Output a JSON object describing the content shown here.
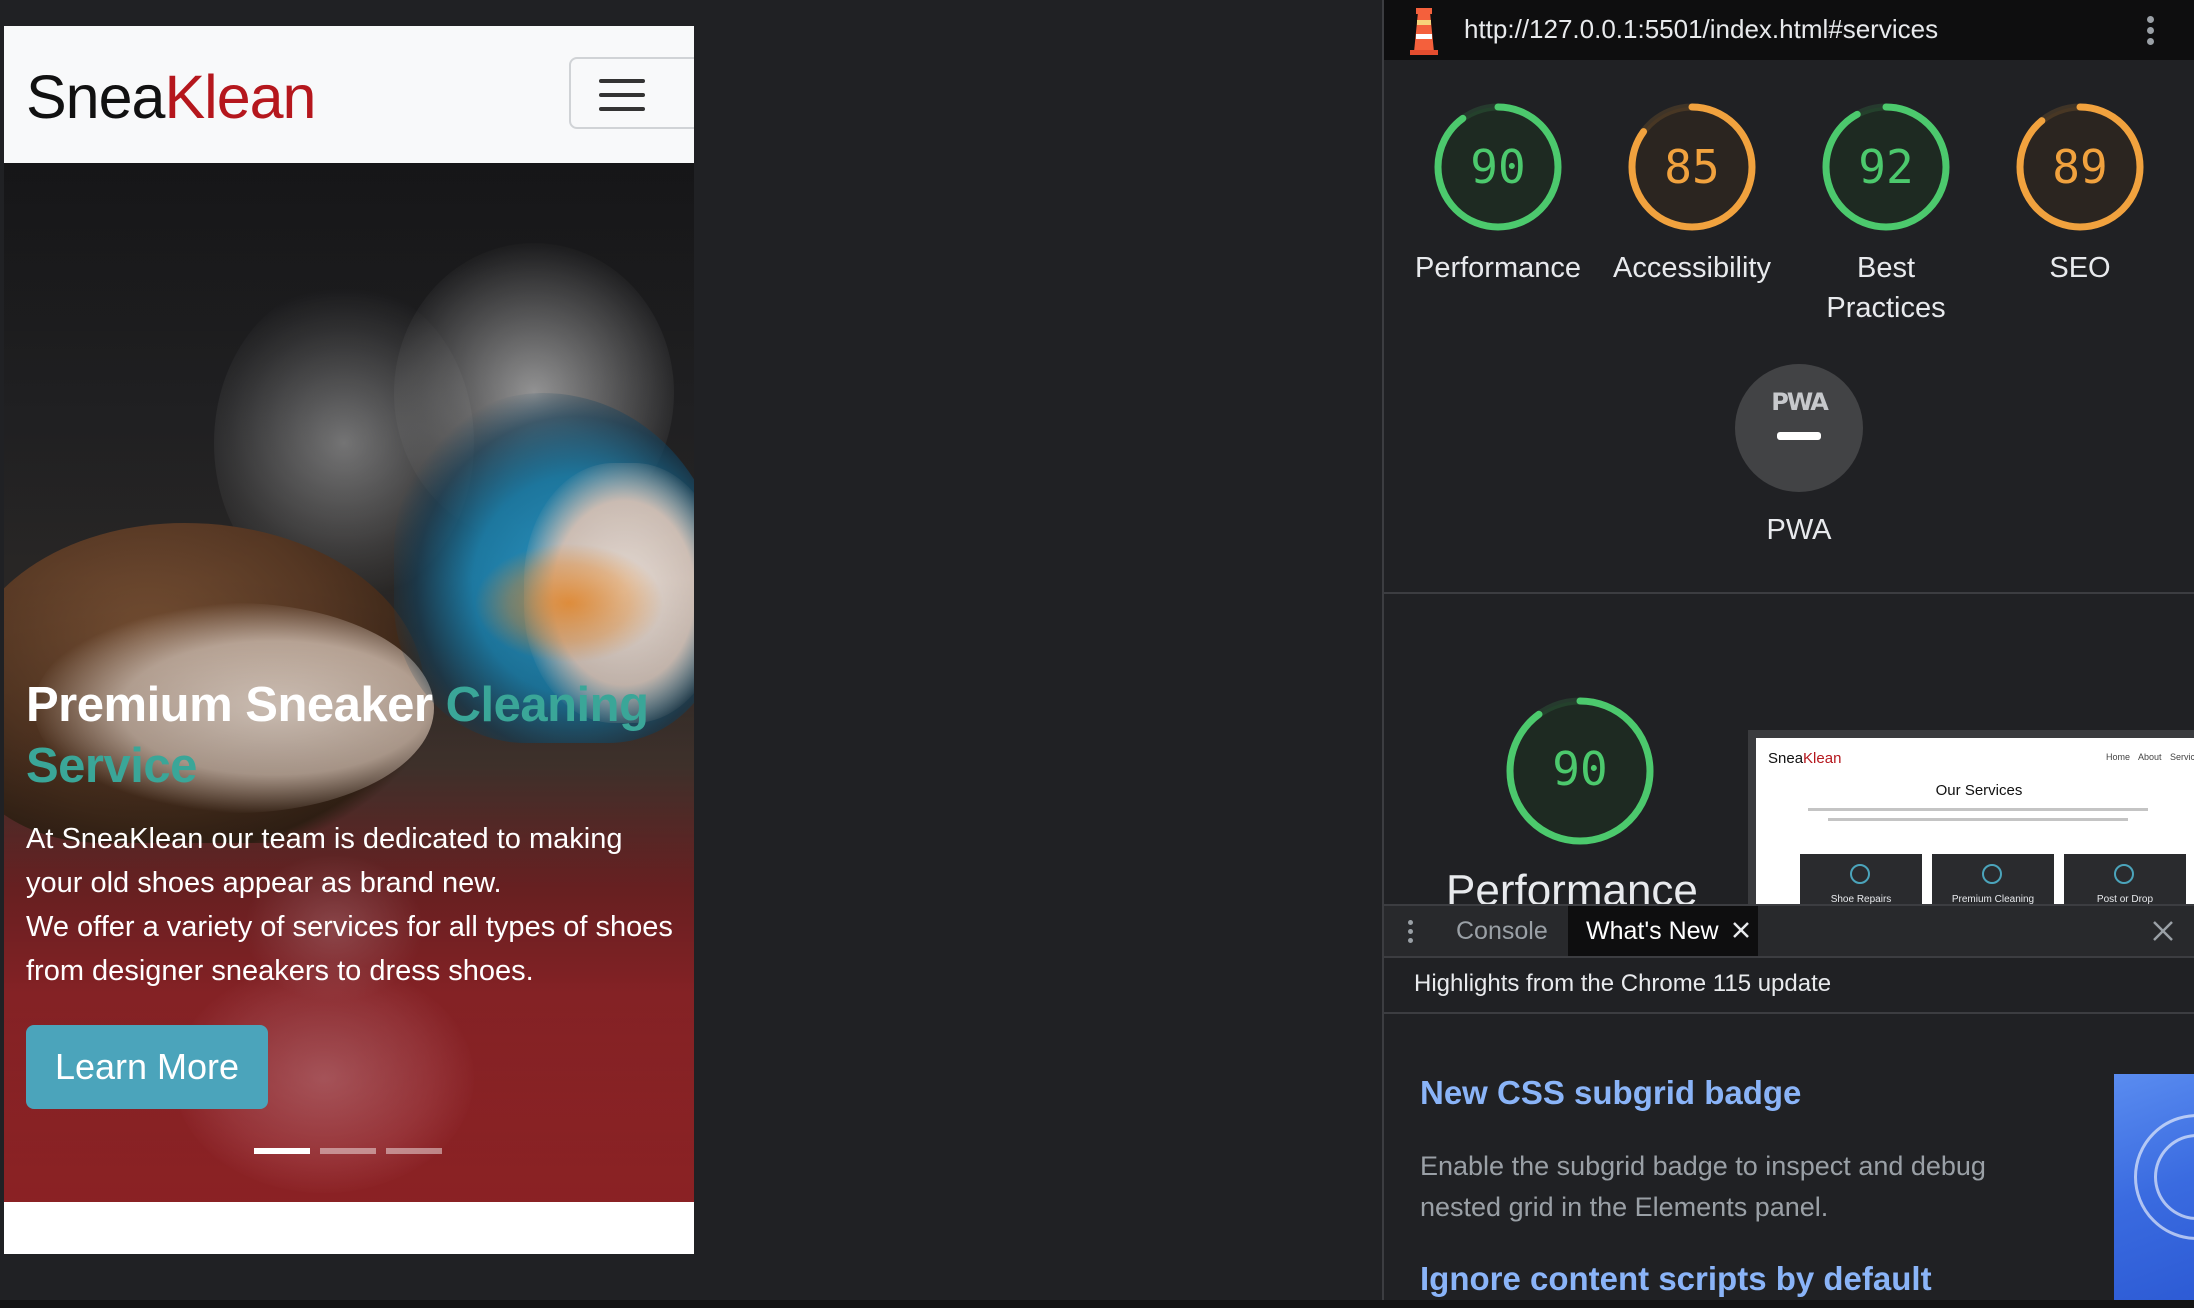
{
  "site": {
    "brand_part1": "Snea",
    "brand_part2": "Klean",
    "hero_title_white": "Premium Sneaker ",
    "hero_title_accent": "Cleaning Service",
    "hero_desc_line1": "At SneaKlean our team is dedicated to making your old shoes appear as brand new.",
    "hero_desc_line2": "We offer a variety of services for all types of shoes from designer sneakers to dress shoes.",
    "learn_more_label": "Learn More",
    "carousel": {
      "slide_count": 3,
      "active_index": 0
    },
    "colors": {
      "brand_red": "#b5171d",
      "accent_teal": "#3aa698",
      "button_blue": "#4ba4bb"
    }
  },
  "devtools": {
    "url": "http://127.0.0.1:5501/index.html#services",
    "categories": [
      {
        "label": "Performance",
        "score": 90,
        "color": "#4cc96d"
      },
      {
        "label": "Accessibility",
        "score": 85,
        "color": "#f1a23e"
      },
      {
        "label": "Best Practices",
        "score": 92,
        "color": "#4cc96d"
      },
      {
        "label": "SEO",
        "score": 89,
        "color": "#f1a23e"
      }
    ],
    "pwa": {
      "badge_text": "PWA",
      "label": "PWA"
    },
    "main_gauge": {
      "score": 90,
      "label": "Performance"
    },
    "thumbnail": {
      "brand_part1": "Snea",
      "brand_part2": "Klean",
      "nav": "Home About Services",
      "heading": "Our Services",
      "cards": [
        "Shoe Repairs",
        "Premium Cleaning",
        "Post or Drop"
      ]
    },
    "drawer": {
      "tabs": [
        "Console",
        "What's New"
      ],
      "active_tab": "What's New",
      "highlight": "Highlights from the Chrome 115 update",
      "features": [
        {
          "title": "New CSS subgrid badge",
          "desc": "Enable the subgrid badge to inspect and debug nested grid in the Elements panel."
        },
        {
          "title": "Ignore content scripts by default"
        }
      ]
    }
  }
}
